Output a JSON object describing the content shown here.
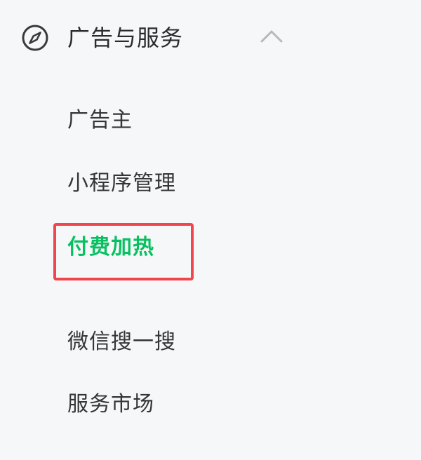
{
  "menu": {
    "group": {
      "title": "广告与服务",
      "icon": "compass-icon",
      "toggle_icon": "chevron-up-icon"
    },
    "items": [
      {
        "label": "广告主",
        "active": false
      },
      {
        "label": "小程序管理",
        "active": false
      },
      {
        "label": "付费加热",
        "active": true
      },
      {
        "label": "微信搜一搜",
        "active": false
      },
      {
        "label": "服务市场",
        "active": false
      }
    ]
  },
  "colors": {
    "background": "#f6f7f9",
    "text": "#353535",
    "active_text": "#07c160",
    "highlight_border": "#f0474f",
    "icon": "#3a3a3a",
    "chevron": "#b8b8b8"
  }
}
